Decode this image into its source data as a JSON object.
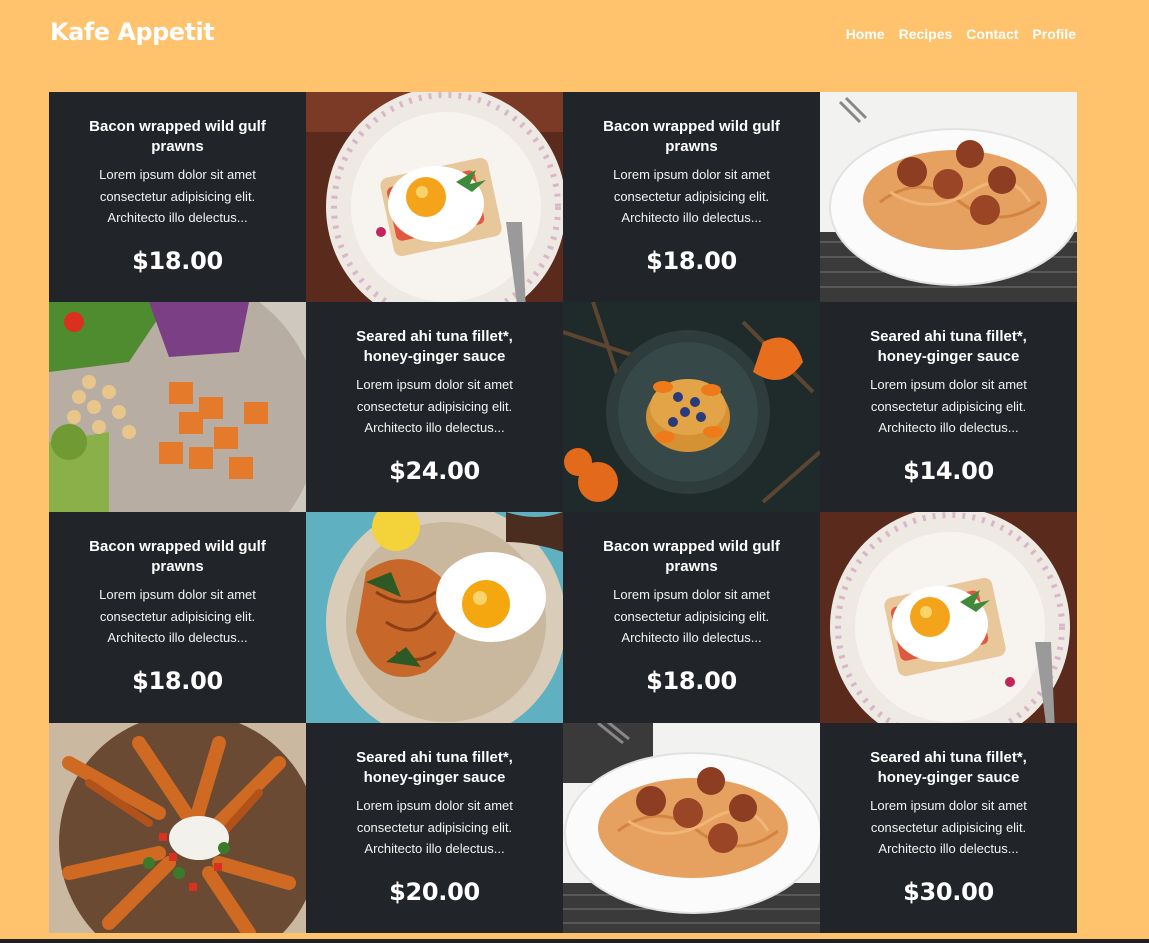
{
  "header": {
    "logo": "Kafe Appetit",
    "nav": [
      "Home",
      "Recipes",
      "Contact",
      "Profile"
    ]
  },
  "menu": [
    {
      "kind": "card",
      "title": "Bacon wrapped wild gulf prawns",
      "desc": "Lorem ipsum dolor sit amet consectetur adipisicing elit. Architecto illo delectus...",
      "price": "$18.00"
    },
    {
      "kind": "image",
      "dish": "egg-toast-image"
    },
    {
      "kind": "card",
      "title": "Bacon wrapped wild gulf prawns",
      "desc": "Lorem ipsum dolor sit amet consectetur adipisicing elit. Architecto illo delectus...",
      "price": "$18.00"
    },
    {
      "kind": "image",
      "dish": "spaghetti-meatballs-image"
    },
    {
      "kind": "image",
      "dish": "chickpea-salad-image"
    },
    {
      "kind": "card",
      "title": "Seared ahi tuna fillet*, honey-ginger sauce",
      "desc": "Lorem ipsum dolor sit amet consectetur adipisicing elit. Architecto illo delectus...",
      "price": "$24.00"
    },
    {
      "kind": "image",
      "dish": "pancakes-image"
    },
    {
      "kind": "card",
      "title": "Seared ahi tuna fillet*, honey-ginger sauce",
      "desc": "Lorem ipsum dolor sit amet consectetur adipisicing elit. Architecto illo delectus...",
      "price": "$14.00"
    },
    {
      "kind": "card",
      "title": "Bacon wrapped wild gulf prawns",
      "desc": "Lorem ipsum dolor sit amet consectetur adipisicing elit. Architecto illo delectus...",
      "price": "$18.00"
    },
    {
      "kind": "image",
      "dish": "egg-noodles-image"
    },
    {
      "kind": "card",
      "title": "Bacon wrapped wild gulf prawns",
      "desc": "Lorem ipsum dolor sit amet consectetur adipisicing elit. Architecto illo delectus...",
      "price": "$18.00"
    },
    {
      "kind": "image",
      "dish": "egg-toast-image"
    },
    {
      "kind": "image",
      "dish": "sweet-potato-fries-image"
    },
    {
      "kind": "card",
      "title": "Seared ahi tuna fillet*, honey-ginger sauce",
      "desc": "Lorem ipsum dolor sit amet consectetur adipisicing elit. Architecto illo delectus...",
      "price": "$20.00"
    },
    {
      "kind": "image",
      "dish": "spaghetti-meatballs-image"
    },
    {
      "kind": "card",
      "title": "Seared ahi tuna fillet*, honey-ginger sauce",
      "desc": "Lorem ipsum dolor sit amet consectetur adipisicing elit. Architecto illo delectus...",
      "price": "$30.00"
    }
  ]
}
